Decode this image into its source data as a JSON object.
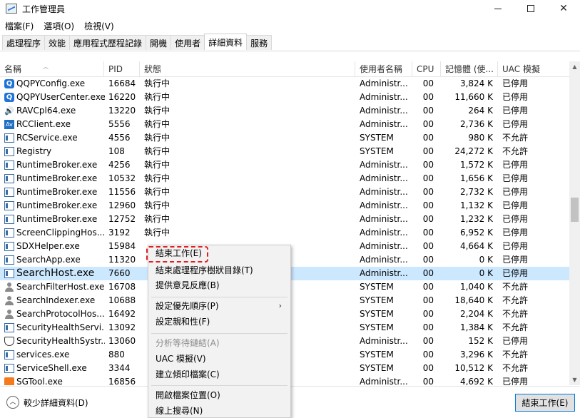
{
  "window": {
    "title": "工作管理員",
    "controls": {
      "minimize": "minimize",
      "maximize": "maximize",
      "close": "✕"
    }
  },
  "menu": [
    "檔案(F)",
    "選項(O)",
    "檢視(V)"
  ],
  "tabs": [
    {
      "label": "處理程序",
      "active": false
    },
    {
      "label": "效能",
      "active": false
    },
    {
      "label": "應用程式歷程記錄",
      "active": false
    },
    {
      "label": "開機",
      "active": false
    },
    {
      "label": "使用者",
      "active": false
    },
    {
      "label": "詳細資料",
      "active": true
    },
    {
      "label": "服務",
      "active": false
    }
  ],
  "columns": {
    "name": "名稱",
    "pid": "PID",
    "status": "狀態",
    "user": "使用者名稱",
    "cpu": "CPU",
    "memory": "記憶體 (使...",
    "uac": "UAC 模擬"
  },
  "rows": [
    {
      "icon": "q",
      "name": "QQPYConfig.exe",
      "pid": "16684",
      "status": "執行中",
      "user": "Administr...",
      "cpu": "00",
      "mem": "3,824 K",
      "uac": "已停用"
    },
    {
      "icon": "q",
      "name": "QQPYUserCenter.exe",
      "pid": "16220",
      "status": "執行中",
      "user": "Administr...",
      "cpu": "00",
      "mem": "11,660 K",
      "uac": "已停用"
    },
    {
      "icon": "speaker",
      "name": "RAVCpl64.exe",
      "pid": "13220",
      "status": "執行中",
      "user": "Administr...",
      "cpu": "00",
      "mem": "264 K",
      "uac": "已停用"
    },
    {
      "icon": "av",
      "name": "RCClient.exe",
      "pid": "5556",
      "status": "執行中",
      "user": "Administr...",
      "cpu": "00",
      "mem": "2,736 K",
      "uac": "已停用"
    },
    {
      "icon": "window",
      "name": "RCService.exe",
      "pid": "4556",
      "status": "執行中",
      "user": "SYSTEM",
      "cpu": "00",
      "mem": "980 K",
      "uac": "不允許"
    },
    {
      "icon": "window",
      "name": "Registry",
      "pid": "108",
      "status": "執行中",
      "user": "SYSTEM",
      "cpu": "00",
      "mem": "24,272 K",
      "uac": "不允許"
    },
    {
      "icon": "window",
      "name": "RuntimeBroker.exe",
      "pid": "4256",
      "status": "執行中",
      "user": "Administr...",
      "cpu": "00",
      "mem": "1,572 K",
      "uac": "已停用"
    },
    {
      "icon": "window",
      "name": "RuntimeBroker.exe",
      "pid": "10532",
      "status": "執行中",
      "user": "Administr...",
      "cpu": "00",
      "mem": "1,656 K",
      "uac": "已停用"
    },
    {
      "icon": "window",
      "name": "RuntimeBroker.exe",
      "pid": "11556",
      "status": "執行中",
      "user": "Administr...",
      "cpu": "00",
      "mem": "2,732 K",
      "uac": "已停用"
    },
    {
      "icon": "window",
      "name": "RuntimeBroker.exe",
      "pid": "12960",
      "status": "執行中",
      "user": "Administr...",
      "cpu": "00",
      "mem": "1,132 K",
      "uac": "已停用"
    },
    {
      "icon": "window",
      "name": "RuntimeBroker.exe",
      "pid": "12752",
      "status": "執行中",
      "user": "Administr...",
      "cpu": "00",
      "mem": "1,232 K",
      "uac": "已停用"
    },
    {
      "icon": "window",
      "name": "ScreenClippingHos...",
      "pid": "3192",
      "status": "執行中",
      "user": "Administr...",
      "cpu": "00",
      "mem": "6,952 K",
      "uac": "已停用"
    },
    {
      "icon": "window",
      "name": "SDXHelper.exe",
      "pid": "15984",
      "status": "",
      "user": "Administr...",
      "cpu": "00",
      "mem": "4,664 K",
      "uac": "已停用"
    },
    {
      "icon": "window",
      "name": "SearchApp.exe",
      "pid": "11320",
      "status": "",
      "user": "Administr...",
      "cpu": "00",
      "mem": "0 K",
      "uac": "已停用"
    },
    {
      "icon": "window",
      "name": "SearchHost.exe",
      "pid": "7660",
      "status": "",
      "user": "Administr...",
      "cpu": "00",
      "mem": "0 K",
      "uac": "已停用",
      "selected": true
    },
    {
      "icon": "person",
      "name": "SearchFilterHost.exe",
      "pid": "16708",
      "status": "",
      "user": "SYSTEM",
      "cpu": "00",
      "mem": "1,040 K",
      "uac": "不允許"
    },
    {
      "icon": "person",
      "name": "SearchIndexer.exe",
      "pid": "10688",
      "status": "",
      "user": "SYSTEM",
      "cpu": "00",
      "mem": "18,640 K",
      "uac": "不允許"
    },
    {
      "icon": "person",
      "name": "SearchProtocolHos...",
      "pid": "16492",
      "status": "",
      "user": "SYSTEM",
      "cpu": "00",
      "mem": "2,204 K",
      "uac": "不允許"
    },
    {
      "icon": "window",
      "name": "SecurityHealthServi...",
      "pid": "13092",
      "status": "",
      "user": "SYSTEM",
      "cpu": "00",
      "mem": "1,384 K",
      "uac": "不允許"
    },
    {
      "icon": "shield",
      "name": "SecurityHealthSystr...",
      "pid": "13060",
      "status": "",
      "user": "Administr...",
      "cpu": "00",
      "mem": "152 K",
      "uac": "已停用"
    },
    {
      "icon": "window",
      "name": "services.exe",
      "pid": "880",
      "status": "",
      "user": "SYSTEM",
      "cpu": "00",
      "mem": "3,296 K",
      "uac": "不允許"
    },
    {
      "icon": "window",
      "name": "ServiceShell.exe",
      "pid": "3344",
      "status": "",
      "user": "SYSTEM",
      "cpu": "00",
      "mem": "10,512 K",
      "uac": "不允許"
    },
    {
      "icon": "orange",
      "name": "SGTool.exe",
      "pid": "16856",
      "status": "",
      "user": "Administr...",
      "cpu": "00",
      "mem": "4,692 K",
      "uac": "已停用"
    }
  ],
  "context_menu": {
    "end_task": "結束工作(E)",
    "end_tree": "結束處理程序樹狀目錄(T)",
    "feedback": "提供意見反應(B)",
    "set_priority": "設定優先順序(P)",
    "set_affinity": "設定親和性(F)",
    "analyze_wait": "分析等待鏈結(A)",
    "uac_virt": "UAC 模擬(V)",
    "create_dump": "建立傾印檔案(C)",
    "open_location": "開啟檔案位置(O)",
    "search_online": "線上搜尋(N)",
    "submenu_arrow": "›"
  },
  "bottom": {
    "fewer_details": "較少詳細資料(D)",
    "fewer_icon": "︿",
    "end_task_button": "結束工作(E)"
  },
  "scroll": {
    "up": "▲",
    "down": "▼",
    "position": 0.45
  },
  "colors": {
    "selection": "#cce8ff",
    "highlight_border": "#e21d1d",
    "accent": "#0078d7"
  }
}
